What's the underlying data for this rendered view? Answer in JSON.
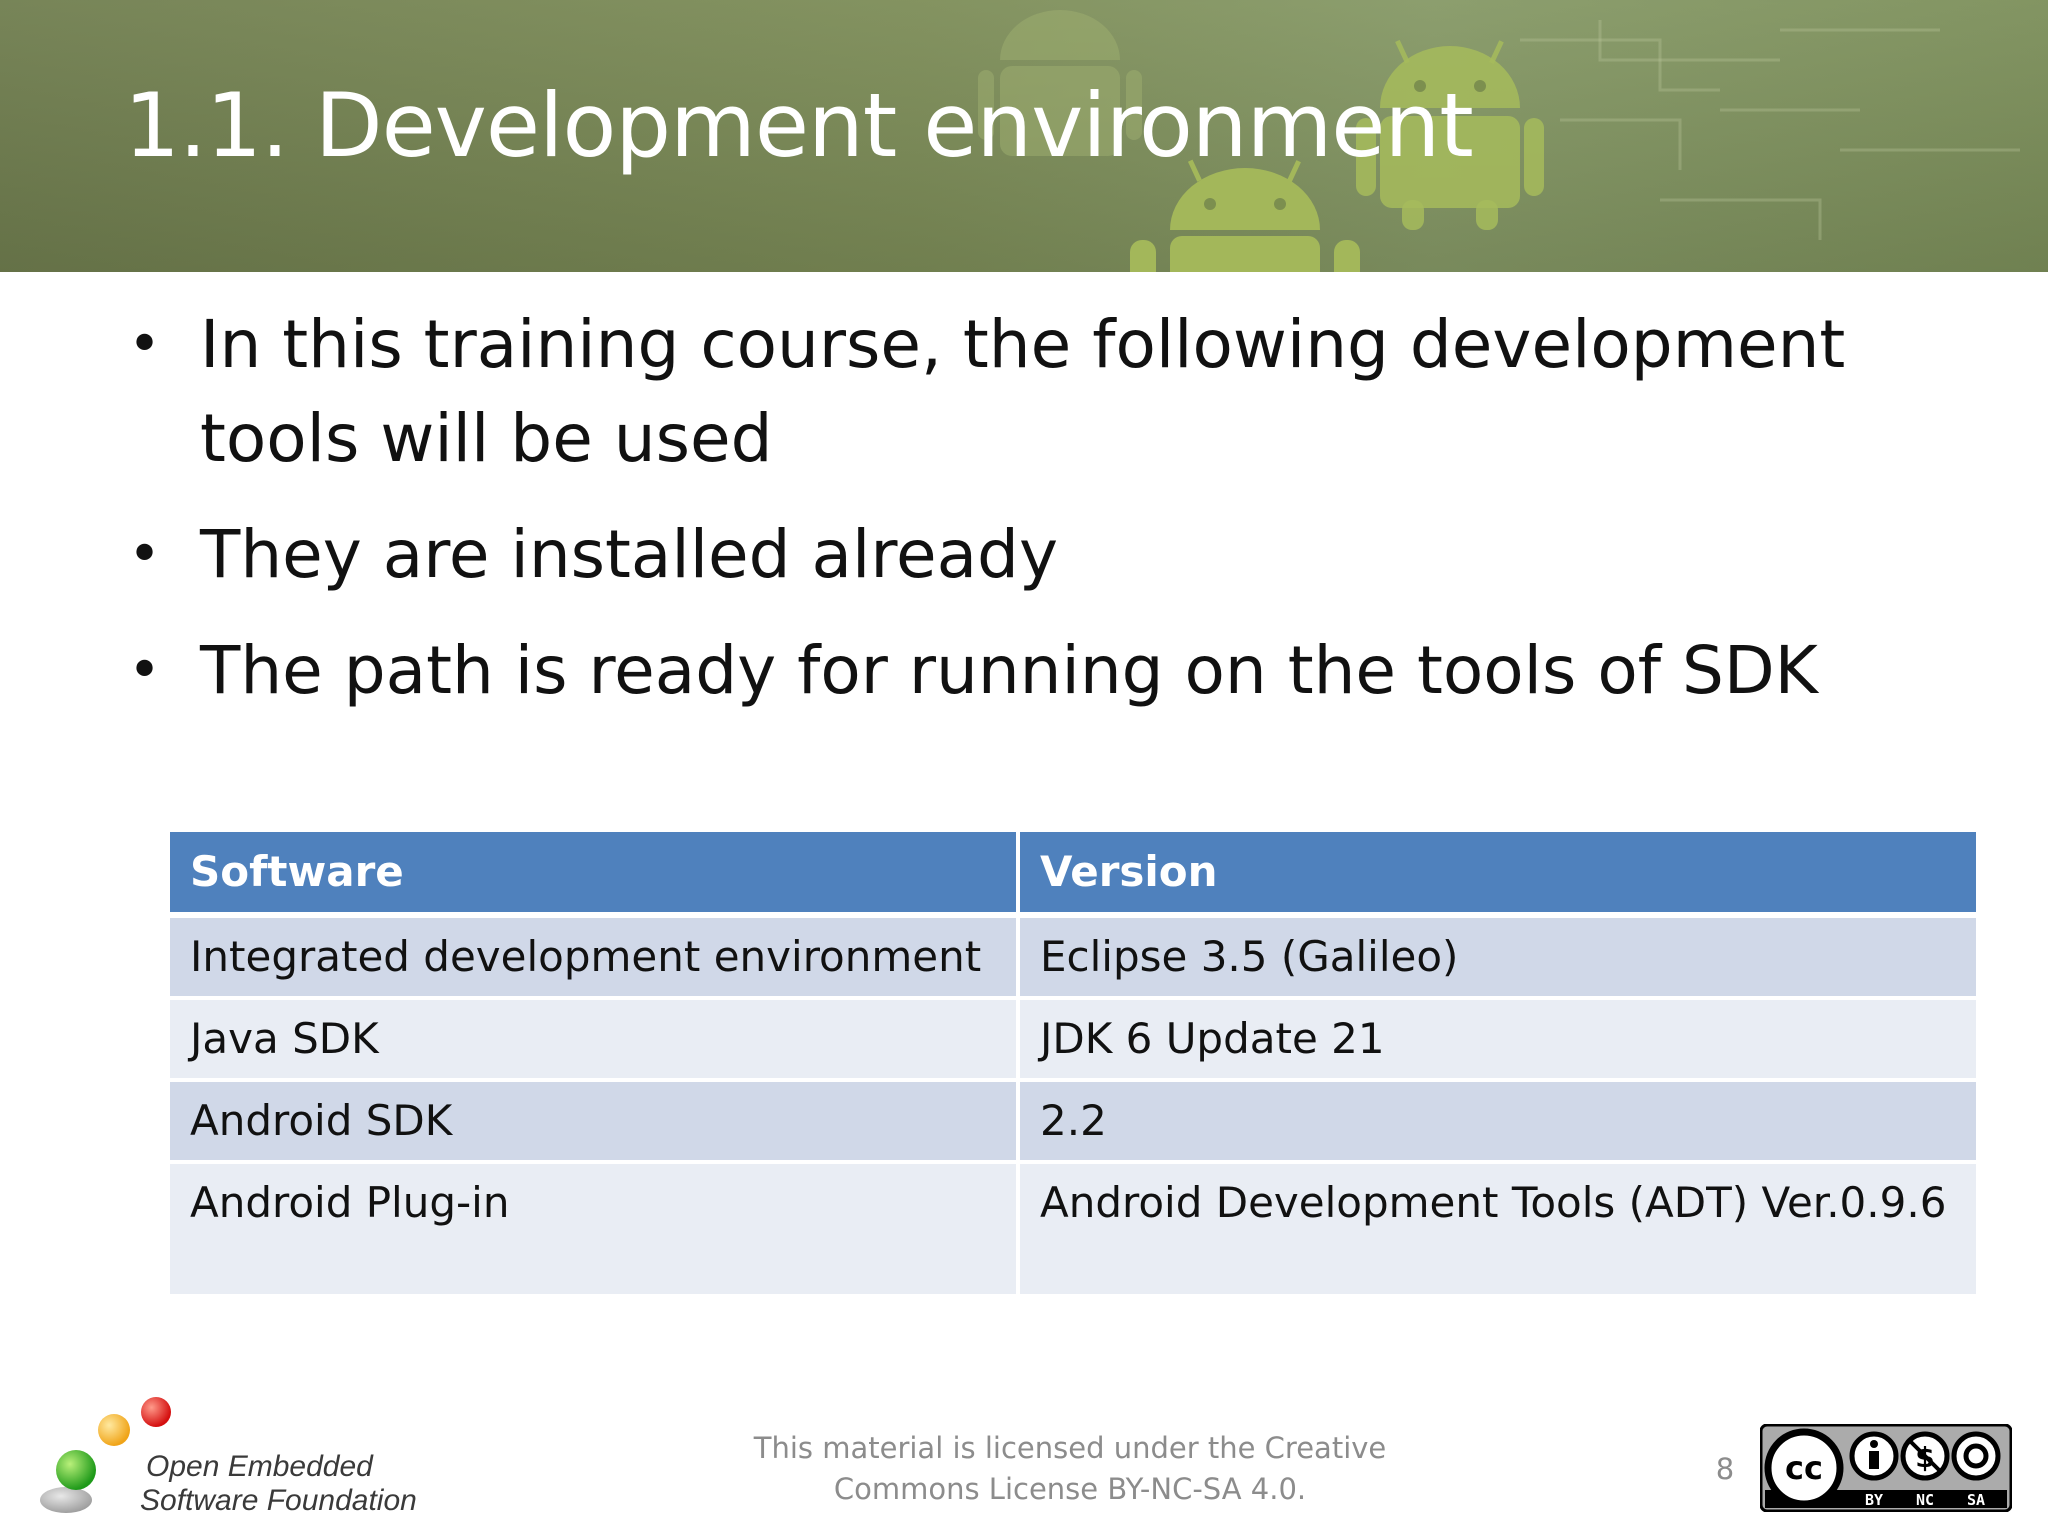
{
  "slide": {
    "title": "1.1. Development environment",
    "page_number": "8"
  },
  "bullets": [
    "In this training course, the following development tools will be used",
    "They are installed already",
    "The path is ready for running on the tools of SDK"
  ],
  "table": {
    "headers": [
      "Software",
      "Version"
    ],
    "rows": [
      [
        "Integrated development environment",
        "Eclipse 3.5 (Galileo)"
      ],
      [
        "Java SDK",
        "JDK 6 Update 21"
      ],
      [
        "Android SDK",
        "2.2"
      ],
      [
        "Android Plug-in",
        "Android Development Tools (ADT)  Ver.0.9.6"
      ]
    ]
  },
  "footer": {
    "logo_line1": "Open Embedded",
    "logo_line2": "Software Foundation",
    "license_line1": "This material is licensed under the Creative",
    "license_line2": "Commons License BY-NC-SA 4.0.",
    "cc_badge": {
      "cc": "cc",
      "by": "BY",
      "nc": "NC",
      "sa": "SA"
    }
  },
  "colors": {
    "header_green": "#7d8d58",
    "table_header": "#4f81bd",
    "table_row_odd": "#d0d8e8",
    "table_row_even": "#e9edf4"
  },
  "icons": [
    "android-robot-icon",
    "oesf-logo-icon",
    "creative-commons-icon"
  ]
}
